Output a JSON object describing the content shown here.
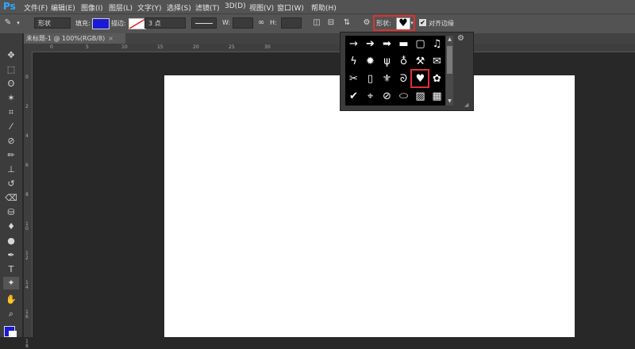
{
  "app": {
    "logo": "Ps"
  },
  "menu": [
    "文件(F)",
    "编辑(E)",
    "图像(I)",
    "图层(L)",
    "文字(Y)",
    "选择(S)",
    "滤镜(T)",
    "3D(D)",
    "视图(V)",
    "窗口(W)",
    "帮助(H)"
  ],
  "options": {
    "mode": "形状",
    "fill_label": "填充:",
    "stroke_label": "描边:",
    "stroke_width": "3 点",
    "w_label": "W:",
    "h_label": "H:",
    "shape_label": "形状:",
    "align_label": "对齐边缘",
    "align_checked": true,
    "fill_color": "#1a1ad6"
  },
  "document": {
    "tab_title": "未标题-1 @ 100%(RGB/8)"
  },
  "ruler_top": [
    "0",
    "5",
    "10",
    "15",
    "20",
    "25",
    "30"
  ],
  "ruler_left": [
    "0",
    "2",
    "4",
    "6",
    "8",
    "1 0",
    "1 2",
    "1 4",
    "1 6",
    "1 8"
  ],
  "shapes_popup": {
    "cells": [
      {
        "icon": "arrow-thin-icon",
        "glyph": "→"
      },
      {
        "icon": "arrow-bold-icon",
        "glyph": "➔"
      },
      {
        "icon": "arrow-fat-icon",
        "glyph": "➡"
      },
      {
        "icon": "banner-icon",
        "glyph": "▬"
      },
      {
        "icon": "frame-icon",
        "glyph": "▢"
      },
      {
        "icon": "music-note-icon",
        "glyph": "♫"
      },
      {
        "icon": "lightning-icon",
        "glyph": "ϟ"
      },
      {
        "icon": "starburst-icon",
        "glyph": "✹"
      },
      {
        "icon": "grass-icon",
        "glyph": "ψ"
      },
      {
        "icon": "lightbulb-icon",
        "glyph": "♁"
      },
      {
        "icon": "hammer-icon",
        "glyph": "⚒"
      },
      {
        "icon": "envelope-icon",
        "glyph": "✉"
      },
      {
        "icon": "scissors-icon",
        "glyph": "✂"
      },
      {
        "icon": "stamp-frame-icon",
        "glyph": "▯"
      },
      {
        "icon": "fleur-de-lis-icon",
        "glyph": "⚜"
      },
      {
        "icon": "snail-icon",
        "glyph": "ᘐ"
      },
      {
        "icon": "heart-icon",
        "glyph": "♥"
      },
      {
        "icon": "puzzle-icon",
        "glyph": "✿"
      },
      {
        "icon": "checkmark-icon",
        "glyph": "✔"
      },
      {
        "icon": "target-icon",
        "glyph": "⌖"
      },
      {
        "icon": "no-sign-icon",
        "glyph": "⊘"
      },
      {
        "icon": "speech-bubble-icon",
        "glyph": "⬭"
      },
      {
        "icon": "hatch-pattern-icon",
        "glyph": "▨"
      },
      {
        "icon": "checker-pattern-icon",
        "glyph": "▦"
      }
    ]
  }
}
